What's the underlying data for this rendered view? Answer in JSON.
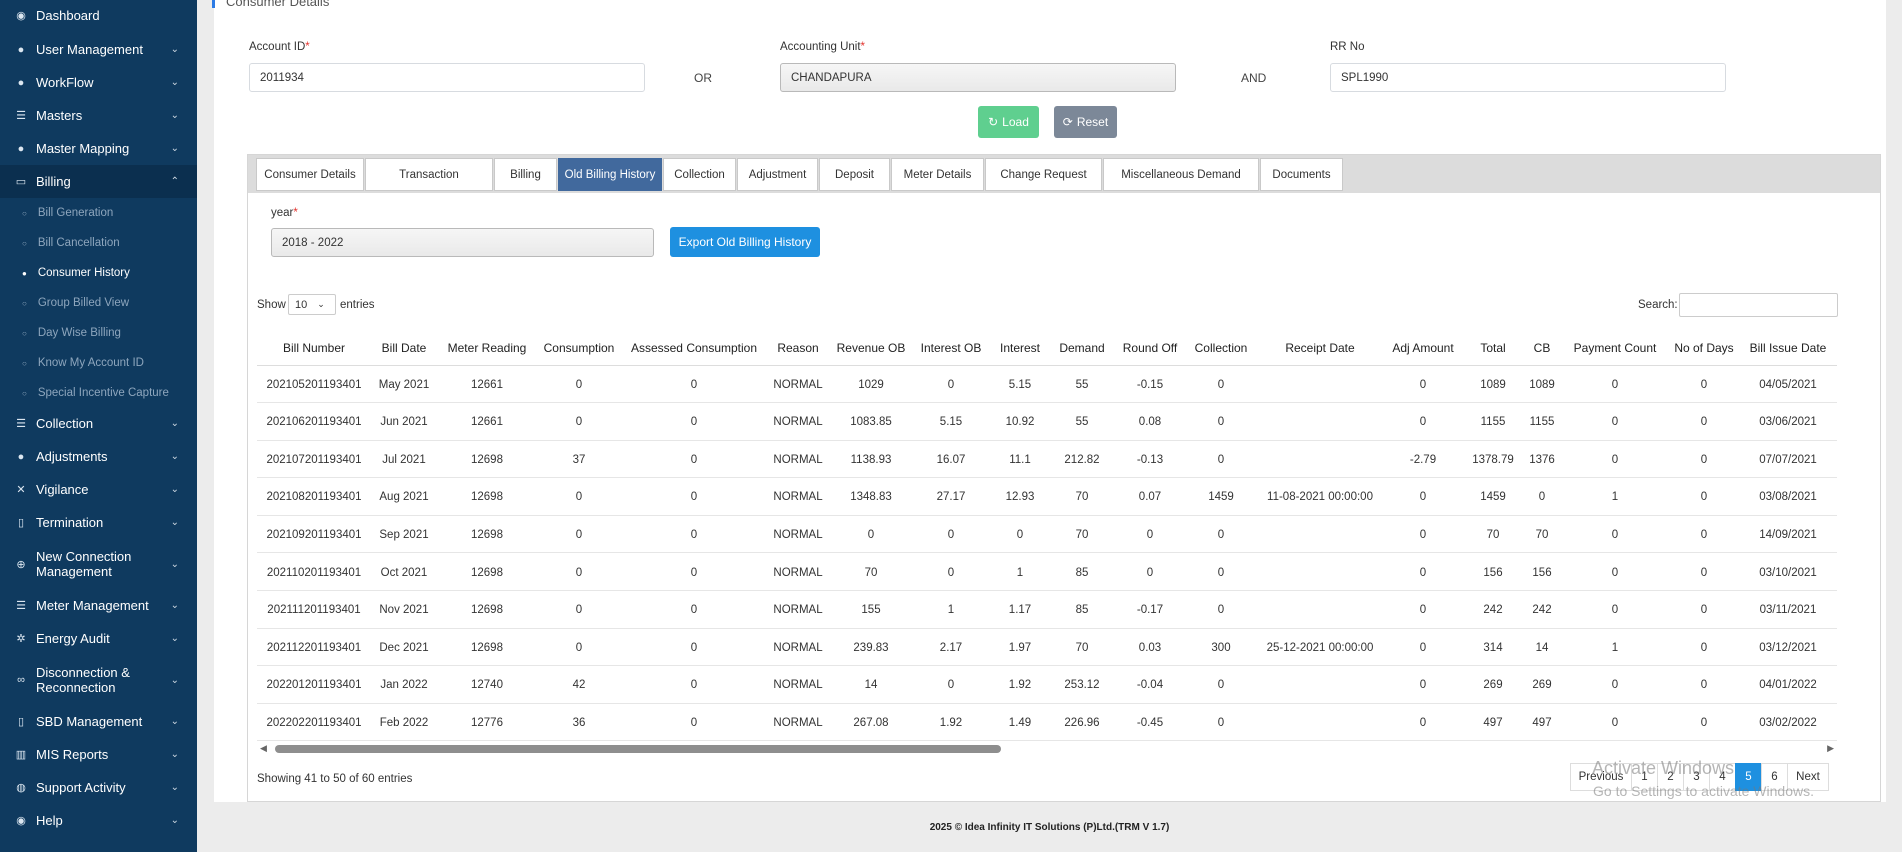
{
  "sidebar": {
    "items": [
      {
        "label": "Dashboard",
        "icon": "dashboard-icon",
        "glyph": "◉",
        "chevron": ""
      },
      {
        "label": "User Management",
        "icon": "user-icon",
        "glyph": "●",
        "chevron": "⌄"
      },
      {
        "label": "WorkFlow",
        "icon": "user-icon",
        "glyph": "●",
        "chevron": "⌄"
      },
      {
        "label": "Masters",
        "icon": "list-icon",
        "glyph": "☰",
        "chevron": "⌄"
      },
      {
        "label": "Master Mapping",
        "icon": "user-icon",
        "glyph": "●",
        "chevron": "⌄"
      },
      {
        "label": "Billing",
        "icon": "monitor-icon",
        "glyph": "▭",
        "chevron": "⌃"
      },
      {
        "label": "Collection",
        "icon": "list-icon",
        "glyph": "☰",
        "chevron": "⌄"
      },
      {
        "label": "Adjustments",
        "icon": "users-icon",
        "glyph": "●",
        "chevron": "⌄"
      },
      {
        "label": "Vigilance",
        "icon": "vk-icon",
        "glyph": "✕",
        "chevron": "⌄"
      },
      {
        "label": "Termination",
        "icon": "trash-icon",
        "glyph": "▯",
        "chevron": "⌄"
      },
      {
        "label": "New Connection Management",
        "icon": "plus-circle-icon",
        "glyph": "⊕",
        "chevron": "⌄"
      },
      {
        "label": "Meter Management",
        "icon": "list-icon",
        "glyph": "☰",
        "chevron": "⌄"
      },
      {
        "label": "Energy Audit",
        "icon": "cogs-icon",
        "glyph": "✲",
        "chevron": "⌄"
      },
      {
        "label": "Disconnection & Reconnection",
        "icon": "link-icon",
        "glyph": "∞",
        "chevron": "⌄"
      },
      {
        "label": "SBD Management",
        "icon": "mobile-icon",
        "glyph": "▯",
        "chevron": "⌄"
      },
      {
        "label": "MIS Reports",
        "icon": "bar-chart-icon",
        "glyph": "▥",
        "chevron": "⌄"
      },
      {
        "label": "Support Activity",
        "icon": "globe-icon",
        "glyph": "◍",
        "chevron": "⌄"
      },
      {
        "label": "Help",
        "icon": "help-icon",
        "glyph": "◉",
        "chevron": "⌄"
      }
    ],
    "billing_sub": [
      "Bill Generation",
      "Bill Cancellation",
      "Consumer History",
      "Group Billed View",
      "Day Wise Billing",
      "Know My Account ID",
      "Special Incentive Capture"
    ]
  },
  "card": {
    "title": "Consumer Details"
  },
  "form": {
    "account_id_label": "Account ID",
    "account_id_value": "2011934",
    "or_label": "OR",
    "accounting_unit_label": "Accounting Unit",
    "accounting_unit_value": "CHANDAPURA",
    "and_label": "AND",
    "rr_no_label": "RR No",
    "rr_no_value": "SPL1990",
    "required_mark": "*",
    "load_label": "Load",
    "reset_label": "Reset"
  },
  "tabs": [
    "Consumer Details",
    "Transaction",
    "Billing",
    "Old Billing History",
    "Collection",
    "Adjustment",
    "Deposit",
    "Meter Details",
    "Change Request",
    "Miscellaneous Demand",
    "Documents"
  ],
  "history": {
    "year_label": "year",
    "year_value": "2018 - 2022",
    "export_label": "Export Old Billing History",
    "show_label": "Show",
    "page_size": "10",
    "entries_label": "entries",
    "search_label": "Search:",
    "showing_text": "Showing 41 to 50 of 60 entries"
  },
  "table": {
    "columns": [
      "Bill Number",
      "Bill Date",
      "Meter Reading",
      "Consumption",
      "Assessed Consumption",
      "Reason",
      "Revenue OB",
      "Interest OB",
      "Interest",
      "Demand",
      "Round Off",
      "Collection",
      "Receipt Date",
      "Adj Amount",
      "Total",
      "CB",
      "Payment Count",
      "No of Days",
      "Bill Issue Date"
    ],
    "rows": [
      [
        "202105201193401",
        "May 2021",
        "12661",
        "0",
        "0",
        "NORMAL",
        "1029",
        "0",
        "5.15",
        "55",
        "-0.15",
        "0",
        "",
        "0",
        "1089",
        "1089",
        "0",
        "0",
        "04/05/2021"
      ],
      [
        "202106201193401",
        "Jun 2021",
        "12661",
        "0",
        "0",
        "NORMAL",
        "1083.85",
        "5.15",
        "10.92",
        "55",
        "0.08",
        "0",
        "",
        "0",
        "1155",
        "1155",
        "0",
        "0",
        "03/06/2021"
      ],
      [
        "202107201193401",
        "Jul 2021",
        "12698",
        "37",
        "0",
        "NORMAL",
        "1138.93",
        "16.07",
        "11.1",
        "212.82",
        "-0.13",
        "0",
        "",
        "-2.79",
        "1378.79",
        "1376",
        "0",
        "0",
        "07/07/2021"
      ],
      [
        "202108201193401",
        "Aug 2021",
        "12698",
        "0",
        "0",
        "NORMAL",
        "1348.83",
        "27.17",
        "12.93",
        "70",
        "0.07",
        "1459",
        "11-08-2021 00:00:00",
        "0",
        "1459",
        "0",
        "1",
        "0",
        "03/08/2021"
      ],
      [
        "202109201193401",
        "Sep 2021",
        "12698",
        "0",
        "0",
        "NORMAL",
        "0",
        "0",
        "0",
        "70",
        "0",
        "0",
        "",
        "0",
        "70",
        "70",
        "0",
        "0",
        "14/09/2021"
      ],
      [
        "202110201193401",
        "Oct 2021",
        "12698",
        "0",
        "0",
        "NORMAL",
        "70",
        "0",
        "1",
        "85",
        "0",
        "0",
        "",
        "0",
        "156",
        "156",
        "0",
        "0",
        "03/10/2021"
      ],
      [
        "202111201193401",
        "Nov 2021",
        "12698",
        "0",
        "0",
        "NORMAL",
        "155",
        "1",
        "1.17",
        "85",
        "-0.17",
        "0",
        "",
        "0",
        "242",
        "242",
        "0",
        "0",
        "03/11/2021"
      ],
      [
        "202112201193401",
        "Dec 2021",
        "12698",
        "0",
        "0",
        "NORMAL",
        "239.83",
        "2.17",
        "1.97",
        "70",
        "0.03",
        "300",
        "25-12-2021 00:00:00",
        "0",
        "314",
        "14",
        "1",
        "0",
        "03/12/2021"
      ],
      [
        "202201201193401",
        "Jan 2022",
        "12740",
        "42",
        "0",
        "NORMAL",
        "14",
        "0",
        "1.92",
        "253.12",
        "-0.04",
        "0",
        "",
        "0",
        "269",
        "269",
        "0",
        "0",
        "04/01/2022"
      ],
      [
        "202202201193401",
        "Feb 2022",
        "12776",
        "36",
        "0",
        "NORMAL",
        "267.08",
        "1.92",
        "1.49",
        "226.96",
        "-0.45",
        "0",
        "",
        "0",
        "497",
        "497",
        "0",
        "0",
        "03/02/2022"
      ]
    ]
  },
  "pagination": {
    "previous": "Previous",
    "pages": [
      "1",
      "2",
      "3",
      "4",
      "5",
      "6"
    ],
    "current": "5",
    "next": "Next"
  },
  "watermark": {
    "line1": "Activate Windows",
    "line2": "Go to Settings to activate Windows."
  },
  "footer": {
    "text": "2025 © Idea Infinity IT Solutions (P)Ltd.(TRM V 1.7)"
  },
  "colors": {
    "sidebar_bg": "#0f3a5f",
    "active_tab": "#41699d",
    "primary": "#1e90e0",
    "load_button": "#5fcf8f",
    "reset_button": "#7c8898"
  }
}
